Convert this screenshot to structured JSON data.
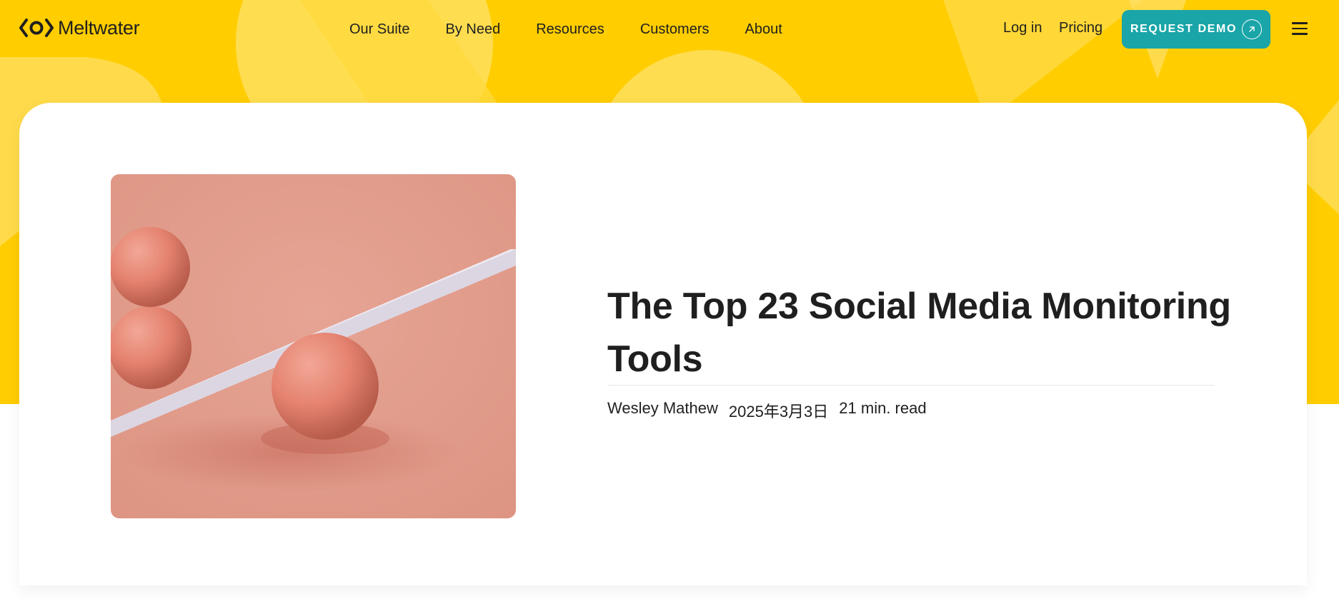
{
  "brand": {
    "name": "Meltwater"
  },
  "nav": {
    "items": [
      {
        "label": "Our Suite"
      },
      {
        "label": "By Need"
      },
      {
        "label": "Resources"
      },
      {
        "label": "Customers"
      },
      {
        "label": "About"
      }
    ]
  },
  "header_actions": {
    "login": "Log in",
    "pricing": "Pricing",
    "demo": "REQUEST DEMO"
  },
  "article": {
    "title": "The Top 23 Social Media Monitoring Tools",
    "author": "Wesley Mathew",
    "date": "2025年3月3日",
    "read_time": "21 min. read"
  },
  "colors": {
    "hero_yellow": "#ffcd00",
    "accent_teal": "#1aa5a8",
    "image_bg": "#e29b8b"
  },
  "icons": {
    "logo": "meltwater-logo-icon",
    "demo_arrow": "arrow-up-right-icon",
    "menu": "hamburger-menu-icon"
  }
}
